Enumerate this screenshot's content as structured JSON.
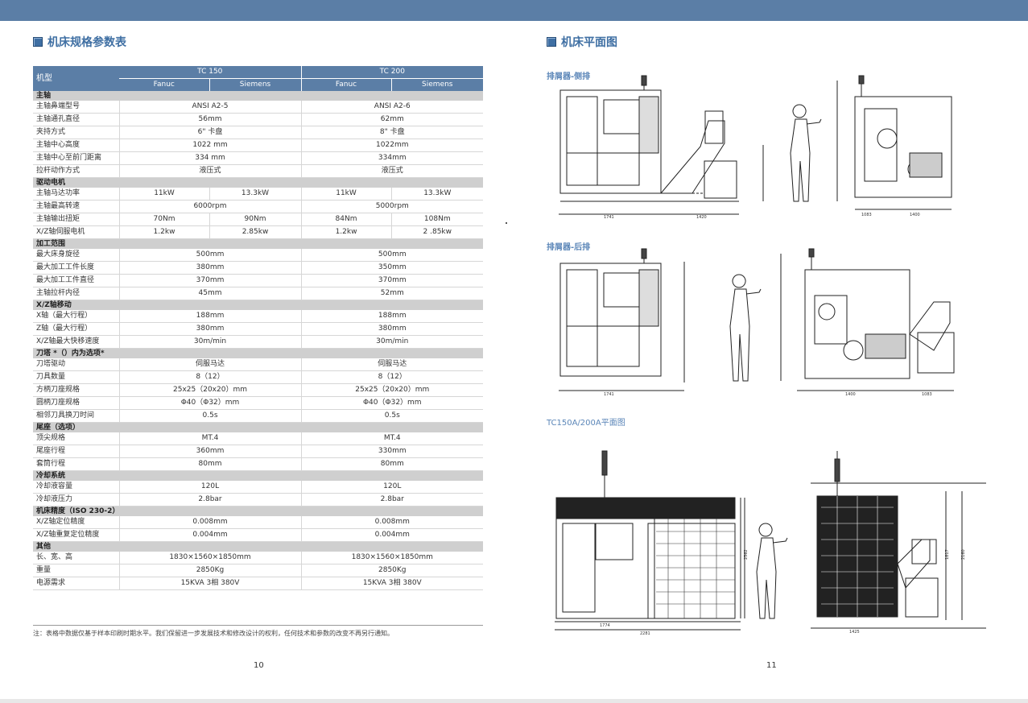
{
  "left": {
    "title": "机床规格参数表",
    "header": {
      "col0": "机型",
      "model1": "TC 150",
      "model2": "TC 200",
      "controllers": [
        "Fanuc",
        "Siemens",
        "Fanuc",
        "Siemens"
      ]
    },
    "rows": [
      {
        "type": "cat",
        "label": "主轴"
      },
      {
        "type": "m",
        "label": "主轴鼻端型号",
        "v1": "ANSI A2-5",
        "v2": "ANSI A2-6"
      },
      {
        "type": "m",
        "label": "主轴通孔直径",
        "v1": "56mm",
        "v2": "62mm"
      },
      {
        "type": "m",
        "label": "夹持方式",
        "v1": "6\" 卡盘",
        "v2": "8\" 卡盘"
      },
      {
        "type": "m",
        "label": "主轴中心高度",
        "v1": "1022 mm",
        "v2": "1022mm"
      },
      {
        "type": "m",
        "label": "主轴中心至前门距离",
        "v1": "334 mm",
        "v2": "334mm"
      },
      {
        "type": "m",
        "label": "拉杆动作方式",
        "v1": "液压式",
        "v2": "液压式"
      },
      {
        "type": "cat",
        "label": "驱动电机"
      },
      {
        "type": "s",
        "label": "主轴马达功率",
        "v": [
          "11kW",
          "13.3kW",
          "11kW",
          "13.3kW"
        ]
      },
      {
        "type": "m",
        "label": "主轴最高转速",
        "v1": "6000rpm",
        "v2": "5000rpm"
      },
      {
        "type": "s",
        "label": "主轴输出扭矩",
        "v": [
          "70Nm",
          "90Nm",
          "84Nm",
          "108Nm"
        ]
      },
      {
        "type": "s",
        "label": "X/Z轴伺服电机",
        "v": [
          "1.2kw",
          "2.85kw",
          "1.2kw",
          "2 .85kw"
        ]
      },
      {
        "type": "cat",
        "label": "加工范围"
      },
      {
        "type": "m",
        "label": "最大床身旋径",
        "v1": "500mm",
        "v2": "500mm"
      },
      {
        "type": "m",
        "label": "最大加工工件长度",
        "v1": "380mm",
        "v2": "350mm"
      },
      {
        "type": "m",
        "label": "最大加工工件直径",
        "v1": "370mm",
        "v2": "370mm"
      },
      {
        "type": "m",
        "label": "主轴拉杆内径",
        "v1": "45mm",
        "v2": "52mm"
      },
      {
        "type": "cat",
        "label": "X/Z轴移动"
      },
      {
        "type": "m",
        "label": "X轴（最大行程）",
        "v1": "188mm",
        "v2": "188mm"
      },
      {
        "type": "m",
        "label": "Z轴（最大行程）",
        "v1": "380mm",
        "v2": "380mm"
      },
      {
        "type": "m",
        "label": "X/Z轴最大快移速度",
        "v1": "30m/min",
        "v2": "30m/min"
      },
      {
        "type": "cat",
        "label": "刀塔 *（）内为选项*"
      },
      {
        "type": "m",
        "label": "刀塔驱动",
        "v1": "伺服马达",
        "v2": "伺服马达"
      },
      {
        "type": "m",
        "label": "刀具数量",
        "v1": "8（12）",
        "v2": "8（12）"
      },
      {
        "type": "m",
        "label": "方柄刀座规格",
        "v1": "25x25（20x20）mm",
        "v2": "25x25（20x20）mm"
      },
      {
        "type": "m",
        "label": "圆柄刀座规格",
        "v1": "Φ40（Φ32）mm",
        "v2": "Φ40（Φ32）mm"
      },
      {
        "type": "m",
        "label": "相邻刀具换刀时间",
        "v1": "0.5s",
        "v2": "0.5s"
      },
      {
        "type": "cat",
        "label": "尾座（选项）"
      },
      {
        "type": "m",
        "label": "顶尖规格",
        "v1": "MT.4",
        "v2": "MT.4"
      },
      {
        "type": "m",
        "label": "尾座行程",
        "v1": "360mm",
        "v2": "330mm"
      },
      {
        "type": "m",
        "label": "套筒行程",
        "v1": "80mm",
        "v2": "80mm"
      },
      {
        "type": "cat",
        "label": "冷却系统"
      },
      {
        "type": "m",
        "label": "冷却液容量",
        "v1": "120L",
        "v2": "120L"
      },
      {
        "type": "m",
        "label": "冷却液压力",
        "v1": "2.8bar",
        "v2": "2.8bar"
      },
      {
        "type": "cat",
        "label": "机床精度（ISO 230-2）"
      },
      {
        "type": "m",
        "label": "X/Z轴定位精度",
        "v1": "0.008mm",
        "v2": "0.008mm"
      },
      {
        "type": "m",
        "label": "X/Z轴重复定位精度",
        "v1": "0.004mm",
        "v2": "0.004mm"
      },
      {
        "type": "cat",
        "label": "其他"
      },
      {
        "type": "m",
        "label": "长、宽、高",
        "v1": "1830×1560×1850mm",
        "v2": "1830×1560×1850mm"
      },
      {
        "type": "m",
        "label": "重量",
        "v1": "2850Kg",
        "v2": "2850Kg"
      },
      {
        "type": "m",
        "label": "电源需求",
        "v1": "15KVA 3相 380V",
        "v2": "15KVA 3相 380V"
      }
    ],
    "footnote": "注：表格中数据仅基于样本印刷时期水平。我们保留进一步发展技术和修改设计的权利，任何技术和参数的改变不再另行通知。",
    "page_number": "10"
  },
  "right": {
    "title": "机床平面图",
    "sub1": "排屑器-侧排",
    "sub2": "排屑器-后排",
    "sub3": "TC150A/200A平面图",
    "page_number": "11",
    "dims1": [
      "1741",
      "1420",
      "1083",
      "1400"
    ],
    "dims2": [
      "1741",
      "1400",
      "1083"
    ],
    "dims3": [
      "1774",
      "2281",
      "1425",
      "2562",
      "1817",
      "2160"
    ]
  }
}
